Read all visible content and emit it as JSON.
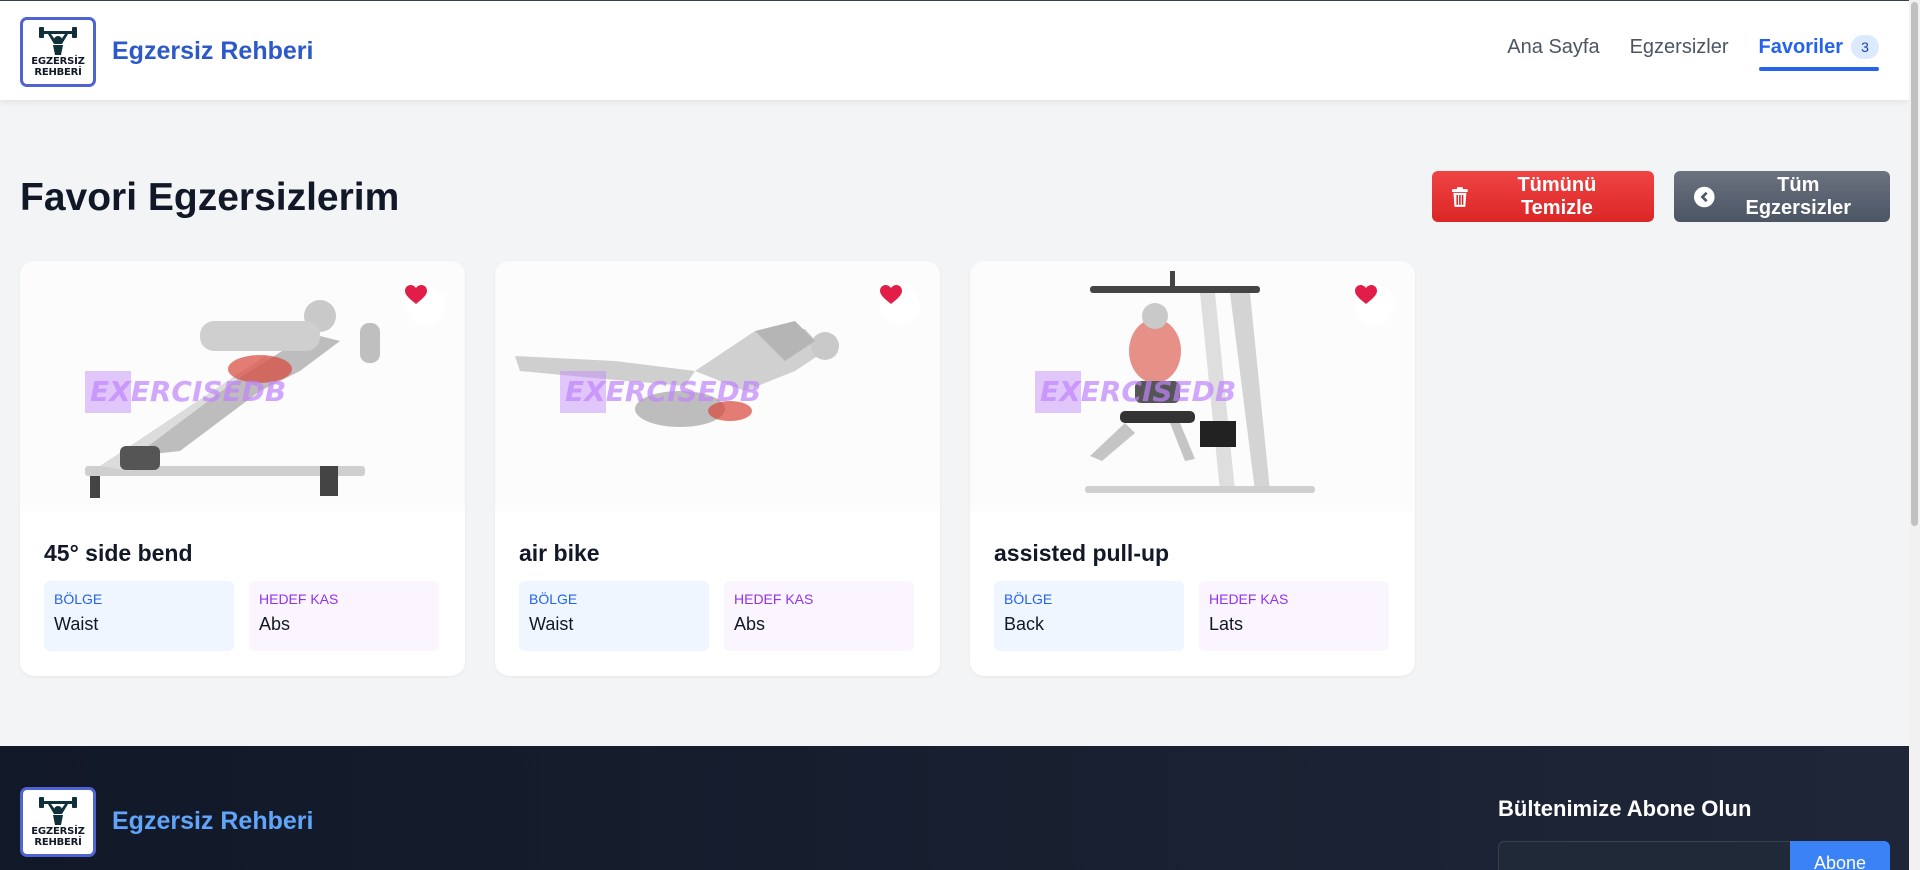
{
  "header": {
    "logo_line1": "EGZERSİZ",
    "logo_line2": "REHBERİ",
    "brand": "Egzersiz Rehberi",
    "nav": [
      {
        "label": "Ana Sayfa"
      },
      {
        "label": "Egzersizler"
      },
      {
        "label": "Favoriler",
        "badge": "3"
      }
    ]
  },
  "main": {
    "title": "Favori Egzersizlerim",
    "clear_button": "Tümünü Temizle",
    "all_button": "Tüm Egzersizler",
    "region_label": "BÖLGE",
    "target_label": "HEDEF KAS",
    "watermark": "EXERCISEDB",
    "cards": [
      {
        "name": "45° side bend",
        "region": "Waist",
        "target": "Abs"
      },
      {
        "name": "air bike",
        "region": "Waist",
        "target": "Abs"
      },
      {
        "name": "assisted pull-up",
        "region": "Back",
        "target": "Lats"
      }
    ]
  },
  "footer": {
    "brand": "Egzersiz Rehberi",
    "logo_line1": "EGZERSİZ",
    "logo_line2": "REHBERİ",
    "newsletter_title": "Bültenimize Abone Olun",
    "subscribe_button": "Abone"
  },
  "colors": {
    "brand_blue": "#2d59c8",
    "active_nav": "#2563eb",
    "danger": "#dc2626",
    "secondary": "#4b5563",
    "heart": "#e11d48"
  }
}
